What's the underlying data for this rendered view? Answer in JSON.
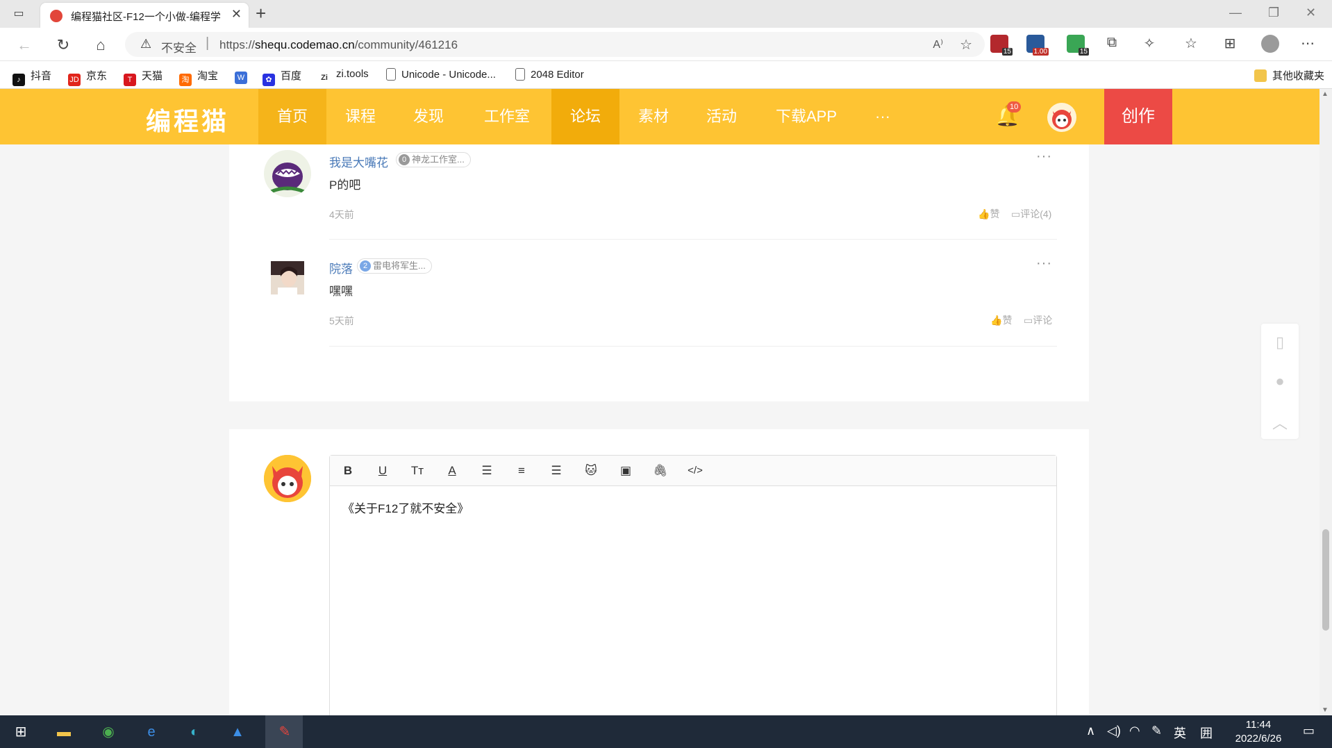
{
  "browser": {
    "tab_title": "编程猫社区-F12一个小做-编程学",
    "insecure_label": "不安全",
    "url_prefix": "https://",
    "url_host": "shequ.codemao.cn",
    "url_path": "/community/461216",
    "ext_badges": [
      "15",
      "1.00",
      "15"
    ]
  },
  "bookmarks": [
    {
      "label": "抖音",
      "icon": "douyin-icon",
      "color": "#111111"
    },
    {
      "label": "京东",
      "icon": "jd-icon",
      "color": "#e1251b"
    },
    {
      "label": "天猫",
      "icon": "tmall-icon",
      "color": "#d8171e"
    },
    {
      "label": "淘宝",
      "icon": "taobao-icon",
      "color": "#ff6a00"
    },
    {
      "label": "",
      "icon": "weibo-icon",
      "color": "#3b6fd8"
    },
    {
      "label": "百度",
      "icon": "baidu-icon",
      "color": "#2932e1"
    },
    {
      "label": "zi.tools",
      "icon": "zitools-icon",
      "color": "#333333"
    },
    {
      "label": "Unicode - Unicode...",
      "icon": "page-icon",
      "color": "#666666"
    },
    {
      "label": "2048 Editor",
      "icon": "page-icon",
      "color": "#666666"
    }
  ],
  "bookmarks_other": "其他收藏夹",
  "site": {
    "logo": "编程猫",
    "nav": [
      "首页",
      "课程",
      "发现",
      "工作室",
      "论坛",
      "素材",
      "活动",
      "下载APP",
      "···"
    ],
    "active_nav": "论坛",
    "notification_count": "10",
    "create_label": "创作",
    "brand_color": "#fec433"
  },
  "comments": [
    {
      "name": "我是大嘴花",
      "level": "0",
      "badge": "神龙工作室...",
      "text": "P的吧",
      "time": "4天前",
      "like": "赞",
      "reply": "评论(4)"
    },
    {
      "name": "院落",
      "level": "2",
      "badge": "雷电将军生...",
      "text": "嘿嘿",
      "time": "5天前",
      "like": "赞",
      "reply": "评论"
    }
  ],
  "more_label": "···",
  "editor": {
    "toolbar": [
      "bold-icon",
      "underline-icon",
      "font-size-icon",
      "font-color-icon",
      "align-left-icon",
      "align-center-icon",
      "align-right-icon",
      "emoji-cat-icon",
      "image-icon",
      "attachment-icon",
      "code-icon"
    ],
    "content": "《关于F12了就不安全》"
  },
  "taskbar": {
    "ime": "英",
    "ime2": "囲",
    "time": "11:44",
    "date": "2022/6/26"
  }
}
